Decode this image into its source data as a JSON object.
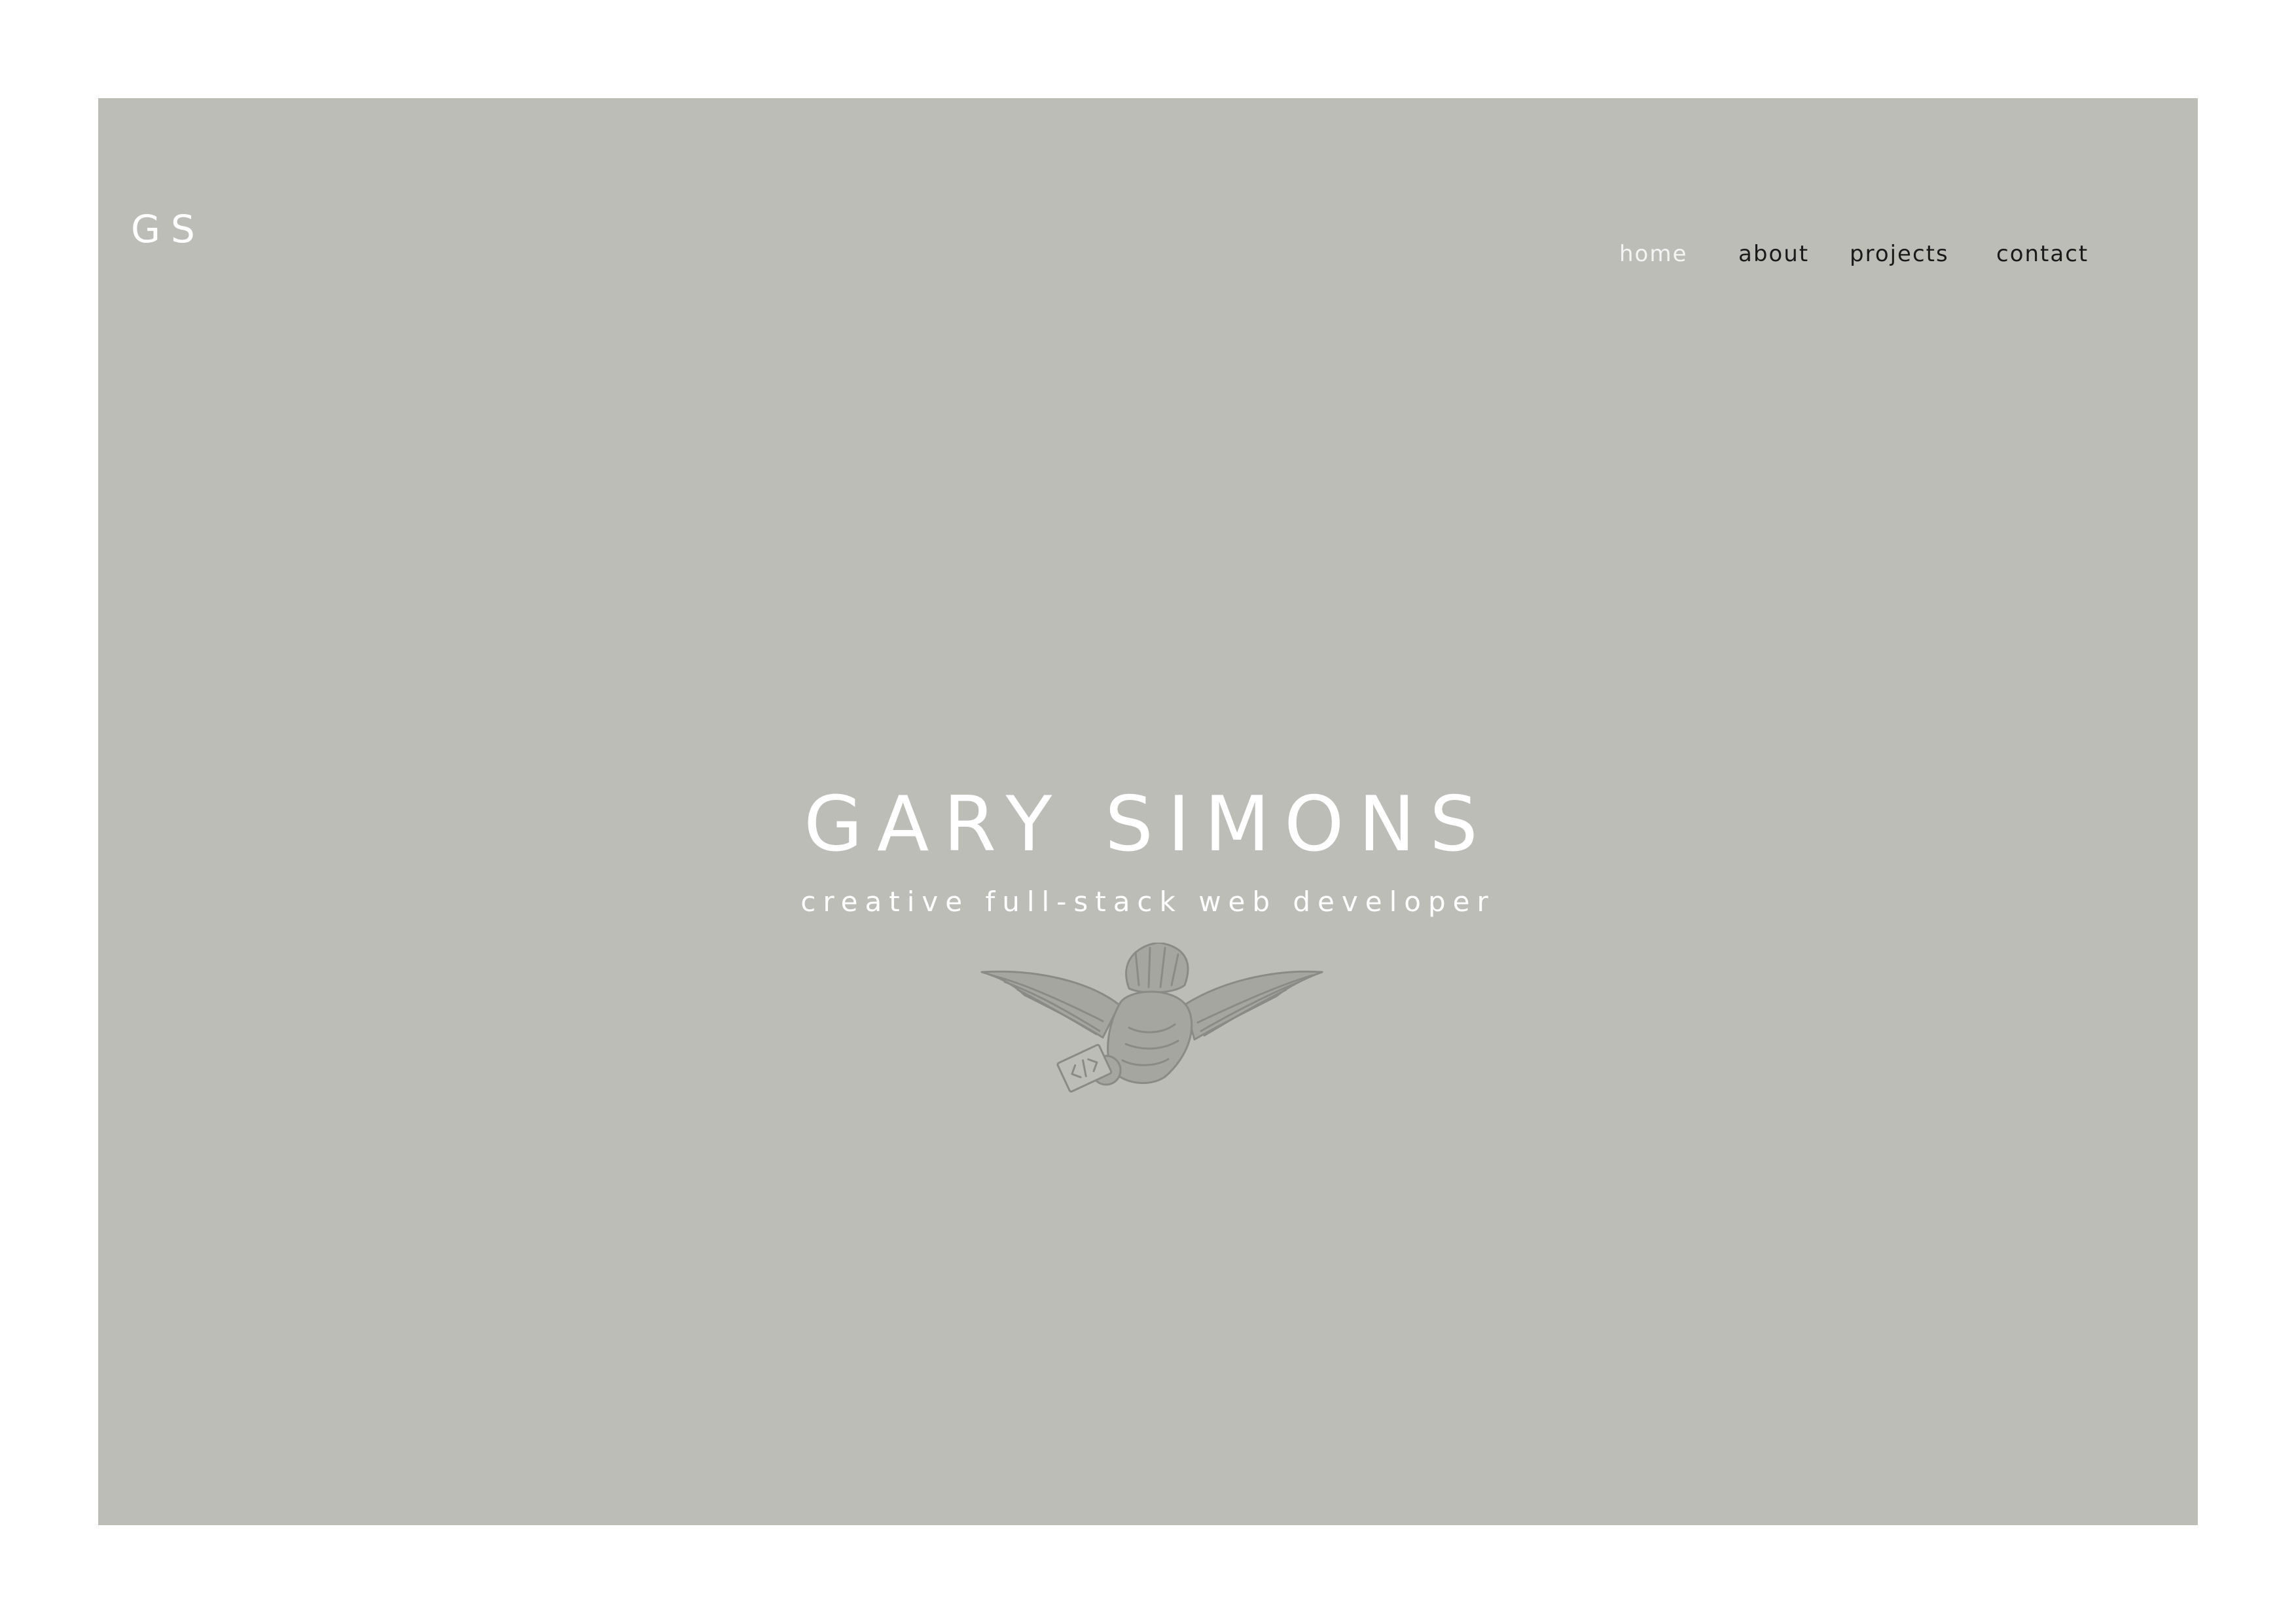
{
  "brand": {
    "logo": "GS"
  },
  "nav": {
    "items": [
      {
        "label": "home",
        "active": true
      },
      {
        "label": "about",
        "active": false
      },
      {
        "label": "projects",
        "active": false
      },
      {
        "label": "contact",
        "active": false
      }
    ]
  },
  "hero": {
    "title": "GARY SIMONS",
    "subtitle": "creative full-stack web developer",
    "emblem_icon": "bird-with-code-envelope-icon",
    "scroll_hint": "v"
  },
  "colors": {
    "background": "#bdbdb8",
    "page": "#ffffff",
    "text_light": "#ffffff",
    "nav_text": "#1a1a1a",
    "emblem": "#8a8a86"
  }
}
